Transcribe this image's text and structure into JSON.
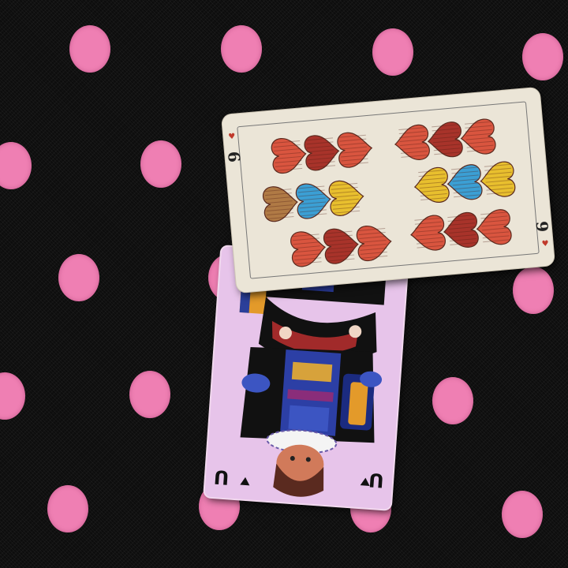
{
  "scene": {
    "background_name": "polka-dot-fabric",
    "background_color": "#0d0d0d",
    "dot_color": "#ef7fb3"
  },
  "cards": {
    "six": {
      "rank_label": "6",
      "suit": "hearts",
      "heart_colors": {
        "red": "#d9553f",
        "red_dark": "#a8332a",
        "yellow": "#e8bf2e",
        "blue": "#3b9fd4",
        "brown": "#b07a45"
      }
    },
    "unter": {
      "rank_label": "U",
      "card_color": "#e7c4ea",
      "orientation": "upside-down"
    }
  }
}
